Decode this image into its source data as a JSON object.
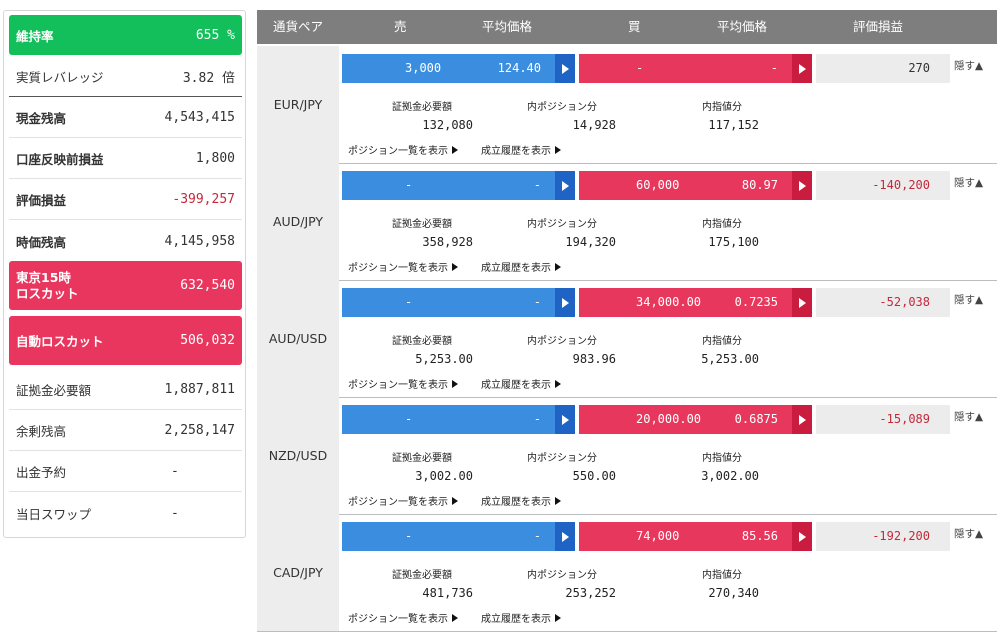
{
  "summary": {
    "maintenance_rate": {
      "label": "維持率",
      "value": "655 %"
    },
    "effective_leverage": {
      "label": "実質レバレッジ",
      "value": "3.82 倍"
    },
    "cash_balance": {
      "label": "現金残高",
      "value": "4,543,415"
    },
    "unreflected_pnl": {
      "label": "口座反映前損益",
      "value": "1,800"
    },
    "valuation_pnl": {
      "label": "評価損益",
      "value": "-399,257"
    },
    "market_balance": {
      "label": "時価残高",
      "value": "4,145,958"
    },
    "tokyo_losscut": {
      "label_line1": "東京15時",
      "label_line2": "ロスカット",
      "value": "632,540"
    },
    "auto_losscut": {
      "label": "自動ロスカット",
      "value": "506,032"
    },
    "margin_required": {
      "label": "証拠金必要額",
      "value": "1,887,811"
    },
    "surplus": {
      "label": "余剰残高",
      "value": "2,258,147"
    },
    "withdrawal_reserve": {
      "label": "出金予約",
      "value": "-"
    },
    "daily_swap": {
      "label": "当日スワップ",
      "value": "-"
    }
  },
  "header": {
    "pair": "通貨ペア",
    "sell": "売",
    "sell_avg": "平均価格",
    "buy": "買",
    "buy_avg": "平均価格",
    "pnl": "評価損益"
  },
  "labels": {
    "margin_required": "証拠金必要額",
    "position_within": "内ポジション分",
    "limit_within": "内指値分",
    "show_positions": "ポジション一覧を表示",
    "show_history": "成立履歴を表示",
    "hide": "隠す▲"
  },
  "rows": [
    {
      "pair": "EUR/JPY",
      "sell_qty": "3,000",
      "sell_avg": "124.40",
      "buy_qty": "-",
      "buy_avg": "-",
      "pnl": "270",
      "margin": "132,080",
      "position": "14,928",
      "limit": "117,152"
    },
    {
      "pair": "AUD/JPY",
      "sell_qty": "-",
      "sell_avg": "-",
      "buy_qty": "60,000",
      "buy_avg": "80.97",
      "pnl": "-140,200",
      "margin": "358,928",
      "position": "194,320",
      "limit": "175,100"
    },
    {
      "pair": "AUD/USD",
      "sell_qty": "-",
      "sell_avg": "-",
      "buy_qty": "34,000.00",
      "buy_avg": "0.7235",
      "pnl": "-52,038",
      "margin": "5,253.00",
      "position": "983.96",
      "limit": "5,253.00"
    },
    {
      "pair": "NZD/USD",
      "sell_qty": "-",
      "sell_avg": "-",
      "buy_qty": "20,000.00",
      "buy_avg": "0.6875",
      "pnl": "-15,089",
      "margin": "3,002.00",
      "position": "550.00",
      "limit": "3,002.00"
    },
    {
      "pair": "CAD/JPY",
      "sell_qty": "-",
      "sell_avg": "-",
      "buy_qty": "74,000",
      "buy_avg": "85.56",
      "pnl": "-192,200",
      "margin": "481,736",
      "position": "253,252",
      "limit": "270,340"
    }
  ],
  "colors": {
    "green": "#12bf5a",
    "red": "#e8365e",
    "sell_blue": "#3b8edf",
    "buy_red": "#e8375d",
    "negative_text": "#c22a3a",
    "header_gray": "#7e7e7e"
  }
}
